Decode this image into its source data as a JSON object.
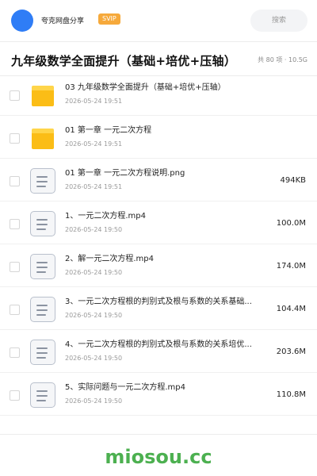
{
  "header": {
    "share_name": "夸克网盘分享",
    "badge": "SVIP",
    "search_placeholder": "搜索"
  },
  "title": {
    "text": "九年级数学全面提升（基础+培优+压轴）",
    "meta": "共 80 项 · 10.5G"
  },
  "items": [
    {
      "type": "folder",
      "name": "03 九年级数学全面提升（基础+培优+压轴）",
      "date": "2026-05-24 19:51",
      "size": ""
    },
    {
      "type": "folder",
      "name": "01 第一章 一元二次方程",
      "date": "2026-05-24 19:51",
      "size": ""
    },
    {
      "type": "file",
      "name": "01 第一章 一元二次方程说明.png",
      "date": "2026-05-24 19:51",
      "size": "494KB"
    },
    {
      "type": "file",
      "name": "1、一元二次方程.mp4",
      "date": "2026-05-24 19:50",
      "size": "100.0M"
    },
    {
      "type": "file",
      "name": "2、解一元二次方程.mp4",
      "date": "2026-05-24 19:50",
      "size": "174.0M"
    },
    {
      "type": "file",
      "name": "3、一元二次方程根的判别式及根与系数的关系基础...",
      "date": "2026-05-24 19:50",
      "size": "104.4M"
    },
    {
      "type": "file",
      "name": "4、一元二次方程根的判别式及根与系数的关系培优...",
      "date": "2026-05-24 19:50",
      "size": "203.6M"
    },
    {
      "type": "file",
      "name": "5、实际问题与一元二次方程.mp4",
      "date": "2026-05-24 19:50",
      "size": "110.8M"
    }
  ],
  "footer": {
    "brand": "miosou.cc"
  },
  "colors": {
    "avatar": "#2f7df6",
    "badge": "#f6a93b",
    "folder": "#fbbd16",
    "brand": "#4cb050"
  },
  "icons": {
    "folder": "folder-icon",
    "file": "document-icon"
  }
}
